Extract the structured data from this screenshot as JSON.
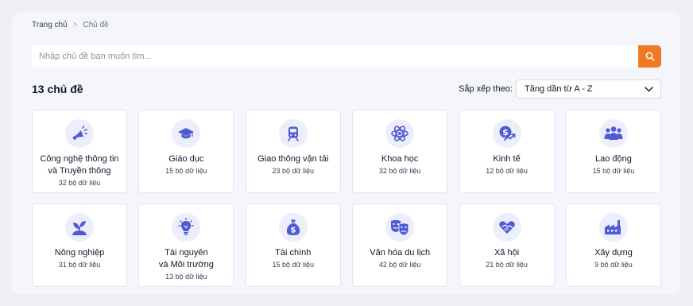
{
  "breadcrumb": {
    "home": "Trang chủ",
    "separator": ">",
    "current": "Chủ đề"
  },
  "search": {
    "placeholder": "Nhập chủ đề bạn muốn tìm...",
    "button_icon": "search-icon"
  },
  "header": {
    "count_label": "13 chủ đề",
    "sort_label": "Sắp xếp theo:",
    "sort_value": "Tăng dần từ A - Z"
  },
  "colors": {
    "accent": "#f07a24",
    "icon": "#4f5bd5",
    "icon_bg": "#eceefb"
  },
  "topics": [
    {
      "name": "Công nghệ thông tin\nvà Truyền thông",
      "count": "32 bộ dữ liệu",
      "icon": "megaphone-icon"
    },
    {
      "name": "Giáo dục",
      "count": "15 bộ dữ liệu",
      "icon": "graduation-cap-icon"
    },
    {
      "name": "Giao thông vận tải",
      "count": "23 bộ dữ liệu",
      "icon": "train-icon"
    },
    {
      "name": "Khoa học",
      "count": "32 bộ dữ liệu",
      "icon": "atom-icon"
    },
    {
      "name": "Kinh tế",
      "count": "12 bộ dữ liệu",
      "icon": "dollar-growth-icon"
    },
    {
      "name": "Lao động",
      "count": "15 bộ dữ liệu",
      "icon": "people-group-icon"
    },
    {
      "name": "Nông nghiệp",
      "count": "31 bộ dữ liệu",
      "icon": "seedling-icon"
    },
    {
      "name": "Tài nguyên\nvà Môi trường",
      "count": "13 bộ dữ liệu",
      "icon": "lightbulb-icon"
    },
    {
      "name": "Tài chính",
      "count": "15 bộ dữ liệu",
      "icon": "money-bag-icon"
    },
    {
      "name": "Văn hóa du lịch",
      "count": "42 bộ dữ liệu",
      "icon": "theater-masks-icon"
    },
    {
      "name": "Xã hội",
      "count": "21 bộ dữ liệu",
      "icon": "handshake-heart-icon"
    },
    {
      "name": "Xây dựng",
      "count": "9 bộ dữ liệu",
      "icon": "factory-icon"
    }
  ]
}
